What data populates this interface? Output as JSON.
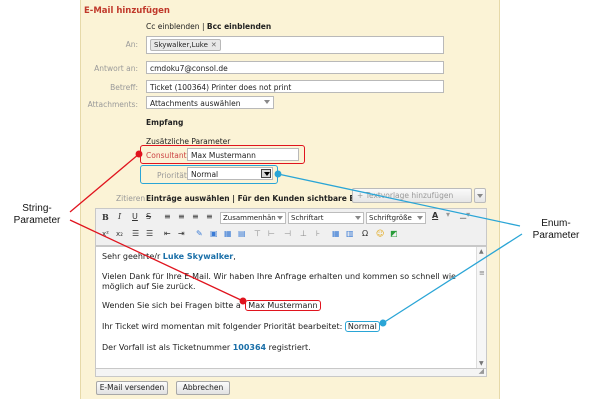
{
  "form": {
    "title": "E-Mail hinzufügen",
    "cc": "Cc einblenden",
    "sep": "|",
    "bcc": "Bcc einblenden",
    "to_label": "An:",
    "to_chip": "Skywalker,Luke",
    "reply_label": "Antwort an:",
    "reply_value": "cmdoku7@consol.de",
    "subject_label": "Betreff:",
    "subject_value": "Ticket (100364) Printer does not print",
    "attach_label": "Attachments:",
    "attach_value": "Attachments auswählen",
    "empfang": "Empfang",
    "zusatz": "Zusätzliche Parameter",
    "consultant_label": "Consultant",
    "consultant_value": "Max Mustermann",
    "prio_label": "Priorität",
    "prio_value": "Normal",
    "zitieren_label": "Zitieren",
    "zitieren_value": "Einträge auswählen | Für den Kunden sichtbare Einträge",
    "textvorlage_button": "Textvorlage hinzufügen"
  },
  "toolbar": {
    "bold": "B",
    "italic": "I",
    "underline": "U",
    "strike": "S",
    "summary_select": "Zusammenhän",
    "font_select": "Schriftart",
    "size_select": "Schriftgröße",
    "super": "x²",
    "sub": "x₂",
    "color_a": "A"
  },
  "editor": {
    "line1_prefix": "Sehr geehrte/r ",
    "line1_name": "Luke Skywalker",
    "line1_suffix": ",",
    "line2": "Vielen Dank für Ihre E-Mail. Wir haben Ihre Anfrage erhalten und kommen so schnell wie",
    "line3": "möglich auf Sie zurück.",
    "line4_prefix": "Wenden Sie sich bei Fragen bitte a",
    "line4_value": "Max Mustermann",
    "line5_prefix": "Ihr Ticket wird momentan mit folgender Priorität bearbeitet:",
    "line5_value": "Normal",
    "line6_prefix": "Der Vorfall ist als Ticketnummer ",
    "line6_number": "100364",
    "line6_suffix": " registriert."
  },
  "buttons": {
    "send": "E-Mail versenden",
    "cancel": "Abbrechen"
  },
  "callouts": {
    "string_line1": "String-",
    "string_line2": "Parameter",
    "enum_line1": "Enum-",
    "enum_line2": "Parameter"
  },
  "colors": {
    "panel": "#fbf3d6",
    "title_red": "#c0392b",
    "annotation_red": "#e0141e",
    "annotation_blue": "#2aa5d6",
    "link_blue": "#1a6fa8"
  }
}
